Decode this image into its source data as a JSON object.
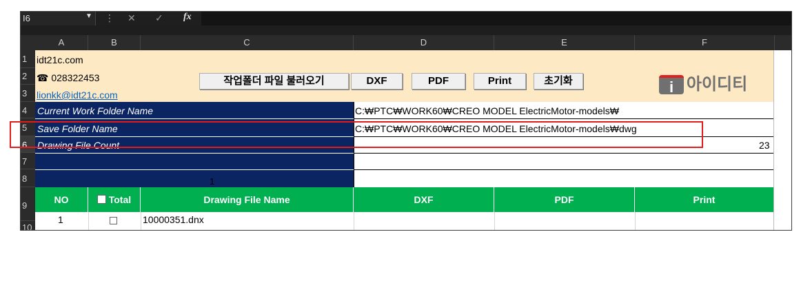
{
  "formula_bar": {
    "name_box": "I6",
    "fx": "fx"
  },
  "columns": [
    "A",
    "B",
    "C",
    "D",
    "E",
    "F"
  ],
  "rows": [
    "1",
    "2",
    "3",
    "4",
    "5",
    "6",
    "7",
    "8",
    "9",
    "10"
  ],
  "info": {
    "site": "idt21c.com",
    "phone": "☎ 028322453",
    "email": "lionkk@idt21c.com"
  },
  "buttons": {
    "load": "작업폴더 파일 불러오기",
    "dxf": "DXF",
    "pdf": "PDF",
    "print": "Print",
    "reset": "초기화"
  },
  "logo": {
    "mark": "i",
    "text": "아이디티"
  },
  "fields": {
    "current_label": "Current Work Folder Name",
    "current_value": "C:₩PTC₩WORK60₩CREO MODEL ElectricMotor-models₩",
    "save_label": "Save Folder  Name",
    "save_value": "C:₩PTC₩WORK60₩CREO MODEL ElectricMotor-models₩dwg",
    "count_label": "Drawing File Count",
    "count_value": "23",
    "row8_value": "1"
  },
  "table": {
    "headers": {
      "no": "NO",
      "total": "Total",
      "name": "Drawing File Name",
      "dxf": "DXF",
      "pdf": "PDF",
      "print": "Print"
    },
    "first_row": {
      "no": "1",
      "name": "10000351.dnx"
    }
  },
  "colors": {
    "navy": "#0b2563",
    "green": "#00b050",
    "info_bg": "#fde9c4",
    "highlight": "#e31b1b"
  }
}
